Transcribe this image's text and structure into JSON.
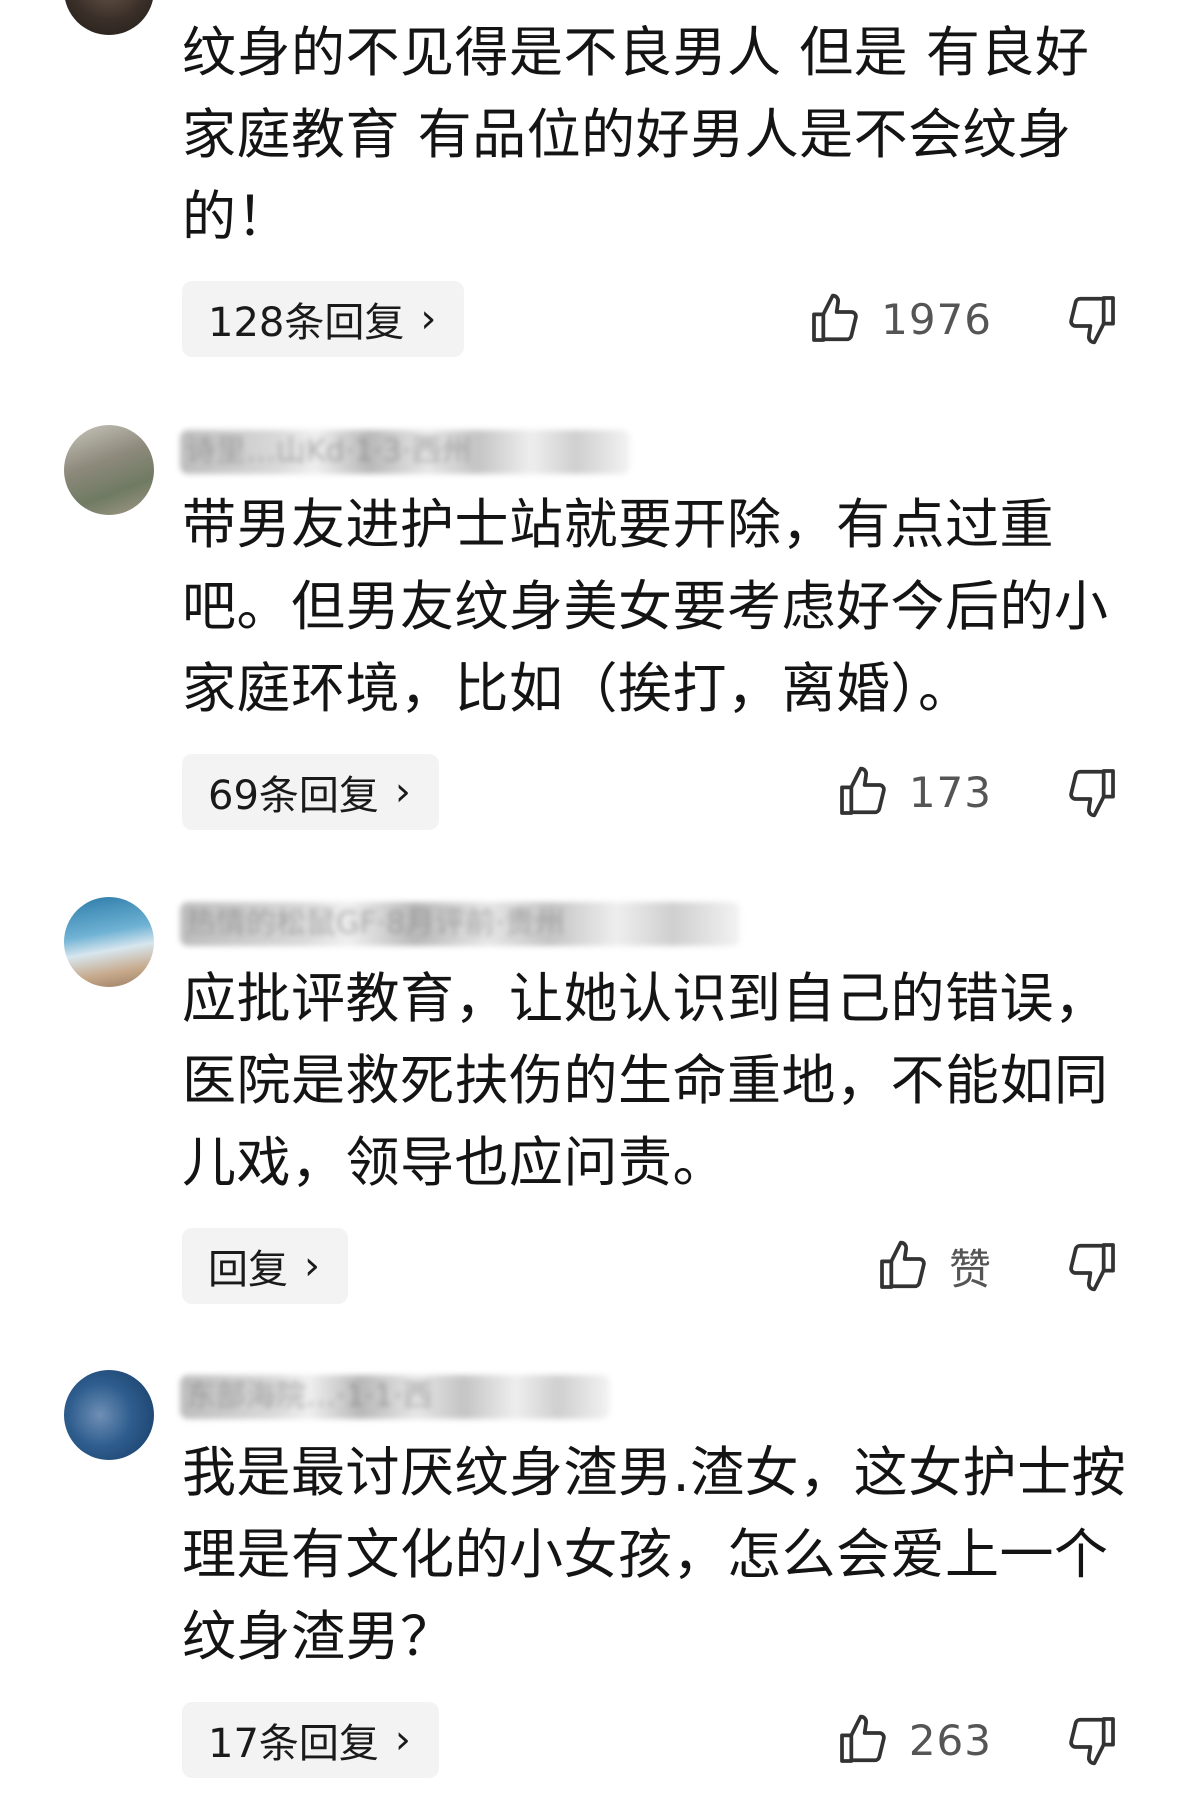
{
  "comments": [
    {
      "username": "",
      "text": "纹身的不见得是不良男人 但是 有良好家庭教育 有品位的好男人是不会纹身的！",
      "reply_label": "128条回复",
      "likes": "1976"
    },
    {
      "username": "诗里…山Kd·1·3·西州",
      "text": "带男友进护士站就要开除，有点过重吧。但男友纹身美女要考虑好今后的小家庭环境，比如（挨打，离婚）。",
      "reply_label": "69条回复",
      "likes": "173"
    },
    {
      "username": "热情的松鼠GF·8月评前·贵州",
      "text": "应批评教育，让她认识到自己的错误，医院是救死扶伤的生命重地，不能如同儿戏，领导也应问责。",
      "reply_label": "回复",
      "likes": "赞"
    },
    {
      "username": "东部海院…·1·1·西",
      "text": "我是最讨厌纹身渣男.渣女，这女护士按理是有文化的小女孩，怎么会爱上一个纹身渣男？",
      "reply_label": "17条回复",
      "likes": "263"
    }
  ],
  "icons": {
    "like": "thumbs-up-icon",
    "dislike": "thumbs-down-icon",
    "chevron": "chevron-right-icon"
  }
}
